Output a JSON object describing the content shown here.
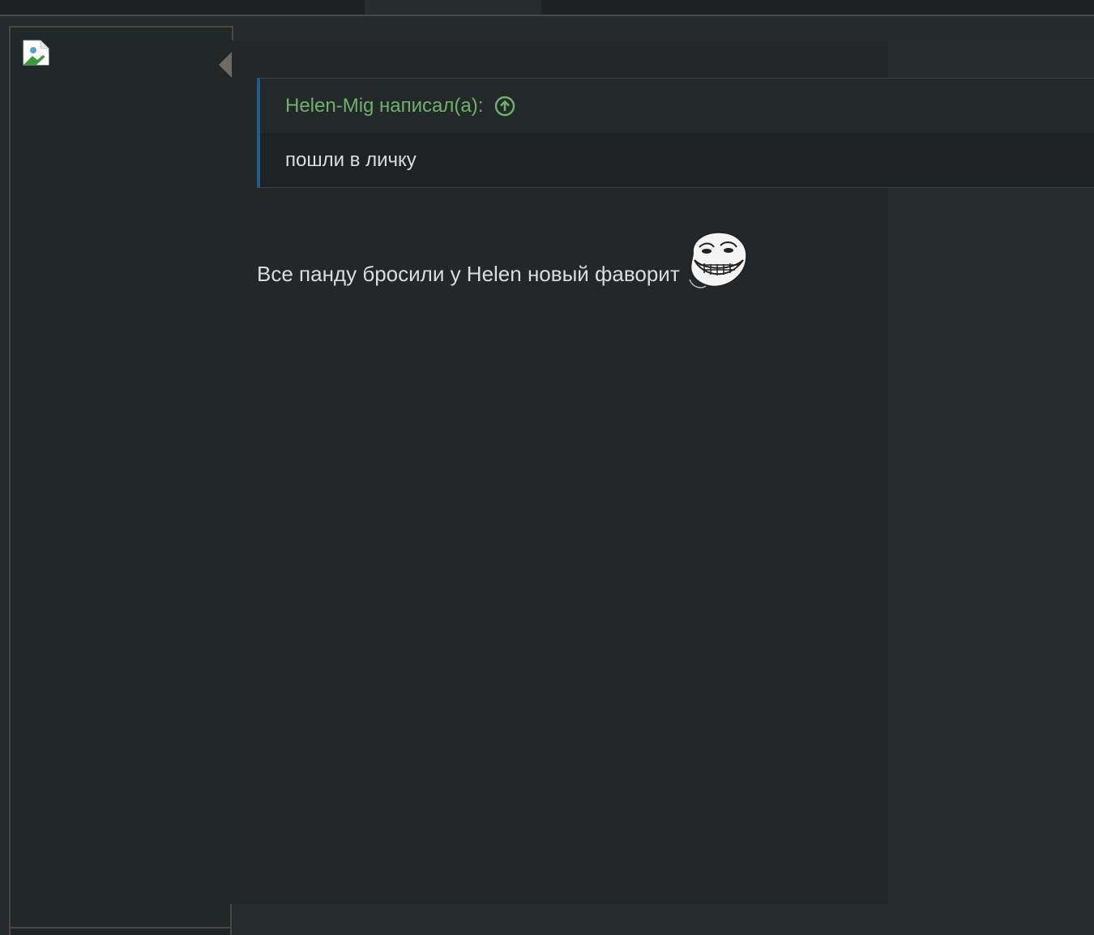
{
  "post": {
    "quote": {
      "author_line": "Helen-Mig написал(а):",
      "text": "пошли в личку"
    },
    "message": "Все панду бросили у Helen новый фаворит"
  },
  "icons": {
    "avatar": "broken-image-icon",
    "jump": "arrow-up-circle-icon",
    "smiley": "trollface-smiley-icon"
  },
  "colors": {
    "quote_author": "#6fb06a",
    "quote_border": "#1d5f8a",
    "text": "#dcdcdc"
  }
}
